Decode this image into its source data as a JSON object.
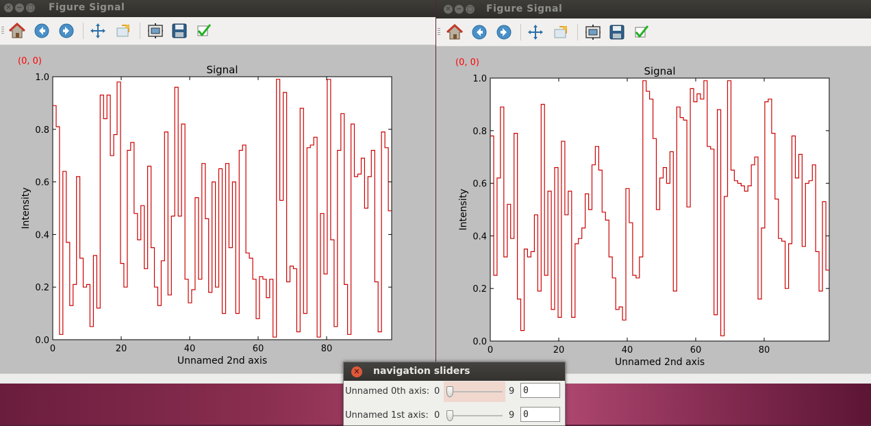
{
  "window1": {
    "title": "Figure  Signal",
    "coord_readout": "(0, 0)",
    "tools": [
      "home-icon",
      "back-arrow-icon",
      "forward-arrow-icon",
      "pan-icon",
      "zoom-icon",
      "subplot-config-icon",
      "save-icon",
      "check-icon"
    ]
  },
  "window2": {
    "title": "Figure  Signal",
    "coord_readout": "(0, 0)",
    "tools": [
      "home-icon",
      "back-arrow-icon",
      "forward-arrow-icon",
      "pan-icon",
      "zoom-icon",
      "subplot-config-icon",
      "save-icon",
      "check-icon"
    ]
  },
  "dialog": {
    "title": "navigation sliders",
    "rows": [
      {
        "label": "Unnamed 0th axis:",
        "min": "0",
        "max": "9",
        "value": "0"
      },
      {
        "label": "Unnamed 1st axis:",
        "min": "0",
        "max": "9",
        "value": "0"
      }
    ]
  },
  "colors": {
    "signal": "#cc0000",
    "readout": "#ff0000"
  },
  "chart_data": [
    {
      "type": "line",
      "style": "step",
      "title": "Signal",
      "xlabel": "Unnamed 2nd axis",
      "ylabel": "Intensity",
      "xlim": [
        0,
        99
      ],
      "ylim": [
        0.0,
        1.0
      ],
      "xticks": [
        "0",
        "20",
        "40",
        "60",
        "80"
      ],
      "yticks": [
        "0.0",
        "0.2",
        "0.4",
        "0.6",
        "0.8",
        "1.0"
      ],
      "grid": false,
      "series": [
        {
          "values": [
            0.89,
            0.81,
            0.02,
            0.64,
            0.37,
            0.13,
            0.21,
            0.62,
            0.31,
            0.2,
            0.21,
            0.05,
            0.32,
            0.12,
            0.93,
            0.84,
            0.93,
            0.7,
            0.78,
            0.98,
            0.29,
            0.2,
            0.72,
            0.75,
            0.48,
            0.38,
            0.51,
            0.27,
            0.66,
            0.35,
            0.2,
            0.13,
            0.3,
            0.79,
            0.17,
            0.47,
            0.96,
            0.47,
            0.82,
            0.23,
            0.14,
            0.19,
            0.54,
            0.23,
            0.67,
            0.46,
            0.18,
            0.6,
            0.2,
            0.65,
            0.1,
            0.67,
            0.35,
            0.6,
            0.1,
            0.72,
            0.74,
            0.33,
            0.31,
            0.23,
            0.08,
            0.24,
            0.23,
            0.16,
            0.23,
            0.01,
            0.99,
            0.53,
            0.94,
            0.22,
            0.28,
            0.27,
            0.03,
            0.88,
            0.1,
            0.73,
            0.74,
            0.77,
            0.01,
            0.48,
            0.25,
            0.99,
            0.38,
            0.05,
            0.72,
            0.86,
            0.21,
            0.02,
            0.82,
            0.62,
            0.63,
            0.69,
            0.5,
            0.62,
            0.72,
            0.22,
            0.03,
            0.79,
            0.73,
            0.49
          ]
        }
      ]
    },
    {
      "type": "line",
      "style": "step",
      "title": "Signal",
      "xlabel": "Unnamed 2nd axis",
      "ylabel": "Intensity",
      "xlim": [
        0,
        99
      ],
      "ylim": [
        0.0,
        1.0
      ],
      "xticks": [
        "0",
        "20",
        "40",
        "60",
        "80"
      ],
      "yticks": [
        "0.0",
        "0.2",
        "0.4",
        "0.6",
        "0.8",
        "1.0"
      ],
      "grid": false,
      "series": [
        {
          "values": [
            0.78,
            0.25,
            0.62,
            0.89,
            0.32,
            0.52,
            0.39,
            0.79,
            0.16,
            0.04,
            0.35,
            0.32,
            0.34,
            0.48,
            0.19,
            0.9,
            0.25,
            0.57,
            0.12,
            0.66,
            0.09,
            0.76,
            0.48,
            0.57,
            0.09,
            0.37,
            0.39,
            0.43,
            0.56,
            0.5,
            0.67,
            0.74,
            0.65,
            0.49,
            0.46,
            0.32,
            0.24,
            0.12,
            0.13,
            0.08,
            0.58,
            0.45,
            0.25,
            0.24,
            0.32,
            0.99,
            0.95,
            0.92,
            0.77,
            0.5,
            0.62,
            0.66,
            0.6,
            0.72,
            0.19,
            0.89,
            0.85,
            0.84,
            0.51,
            0.96,
            0.91,
            0.94,
            0.92,
            0.99,
            0.74,
            0.73,
            0.1,
            0.88,
            0.02,
            0.55,
            0.99,
            0.65,
            0.61,
            0.6,
            0.59,
            0.57,
            0.59,
            0.67,
            0.7,
            0.16,
            0.43,
            0.91,
            0.92,
            0.79,
            0.54,
            0.39,
            0.38,
            0.2,
            0.37,
            0.78,
            0.62,
            0.71,
            0.36,
            0.6,
            0.61,
            0.67,
            0.34,
            0.19,
            0.53,
            0.27
          ]
        }
      ]
    }
  ]
}
